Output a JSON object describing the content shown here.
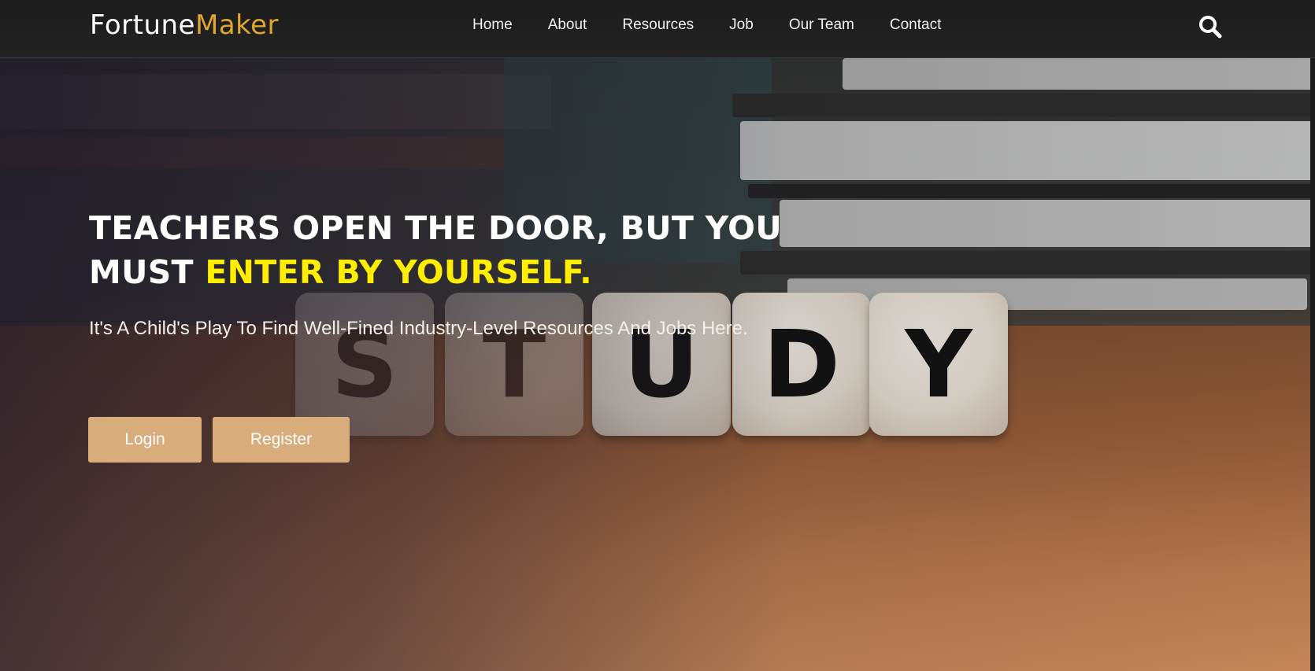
{
  "brand": {
    "name_part1": "Fortune",
    "name_part2": "Maker",
    "accent_color": "#e0a630"
  },
  "nav": {
    "items": [
      {
        "label": "Home"
      },
      {
        "label": "About"
      },
      {
        "label": "Resources"
      },
      {
        "label": "Job"
      },
      {
        "label": "Our Team"
      },
      {
        "label": "Contact"
      }
    ],
    "search_icon": "search-icon"
  },
  "hero": {
    "headline_line1": "TEACHERS OPEN THE DOOR, BUT YOU",
    "headline_line2_plain": "MUST ",
    "headline_line2_highlight": "ENTER BY YOURSELF.",
    "highlight_color": "#ffee00",
    "subtitle": "It's A Child's Play To Find Well-Fined Industry-Level Resources And Jobs Here.",
    "dice_letters": [
      "S",
      "T",
      "U",
      "D",
      "Y"
    ]
  },
  "buttons": {
    "login": "Login",
    "register": "Register",
    "color": "#d8ac7b"
  }
}
